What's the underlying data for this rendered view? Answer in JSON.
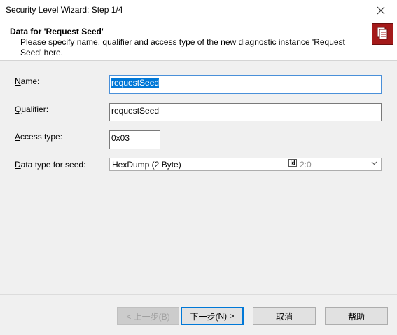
{
  "window": {
    "title": "Security Level Wizard: Step 1/4"
  },
  "header": {
    "title": "Data for 'Request Seed'",
    "description": "Please specify name, qualifier and access type of the new diagnostic instance 'Request Seed' here."
  },
  "form": {
    "name": {
      "label_accel": "N",
      "label_rest": "ame:",
      "value": "requestSeed"
    },
    "qualifier": {
      "label_accel": "Q",
      "label_rest": "ualifier:",
      "value": "requestSeed"
    },
    "access_type": {
      "label_accel": "A",
      "label_rest": "ccess type:",
      "value": "0x03"
    },
    "data_type": {
      "label_accel": "D",
      "label_rest": "ata type for seed:",
      "value": "HexDump (2 Byte)",
      "id_badge": "id",
      "id_value": "2:0"
    }
  },
  "buttons": {
    "back": "< 上一步(B)",
    "next_pre": "下一步(",
    "next_accel": "N",
    "next_post": ") >",
    "cancel": "取消",
    "help": "帮助"
  },
  "colors": {
    "accent": "#0078d7",
    "header_icon": "#a41a1a"
  }
}
